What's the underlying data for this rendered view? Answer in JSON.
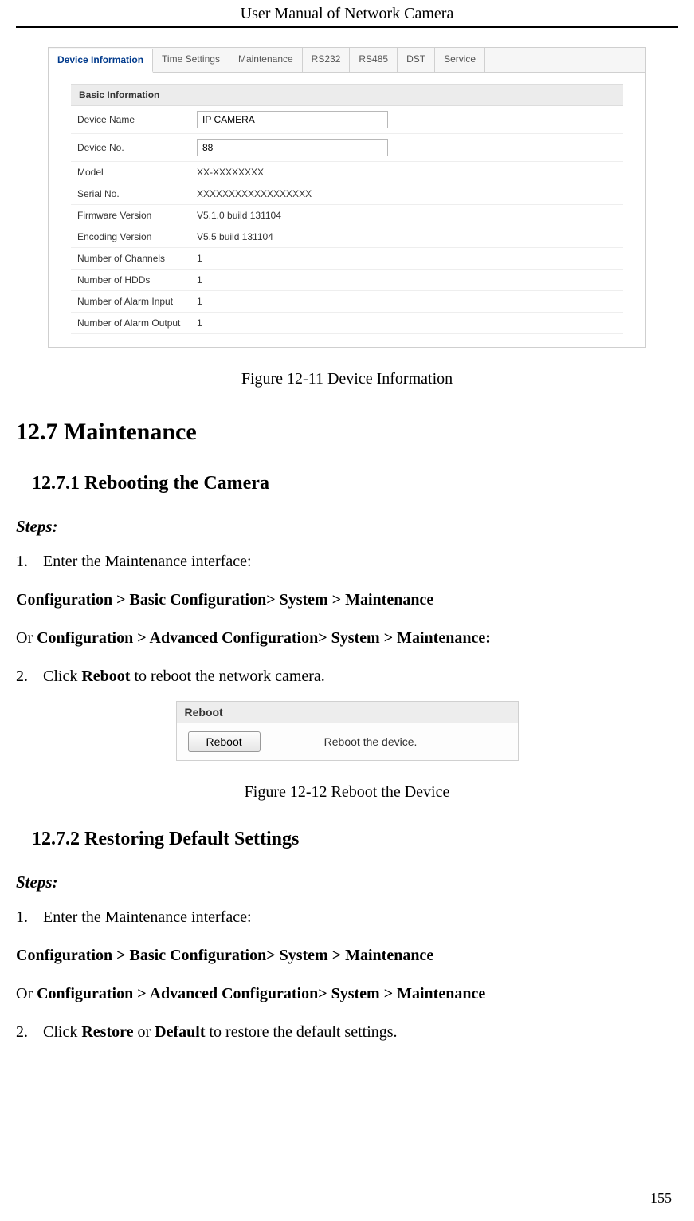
{
  "header": "User Manual of Network Camera",
  "pageNumber": "155",
  "fig1": {
    "tabs": [
      "Device Information",
      "Time Settings",
      "Maintenance",
      "RS232",
      "RS485",
      "DST",
      "Service"
    ],
    "activeTab": 0,
    "sectionHeader": "Basic Information",
    "inputs": {
      "deviceNameLabel": "Device Name",
      "deviceNameValue": "IP CAMERA",
      "deviceNoLabel": "Device No.",
      "deviceNoValue": "88"
    },
    "rows": [
      {
        "label": "Model",
        "value": "XX-XXXXXXXX"
      },
      {
        "label": "Serial No.",
        "value": "XXXXXXXXXXXXXXXXXX"
      },
      {
        "label": "Firmware Version",
        "value": "V5.1.0 build 131104"
      },
      {
        "label": "Encoding Version",
        "value": "V5.5 build 131104"
      },
      {
        "label": "Number of Channels",
        "value": "1"
      },
      {
        "label": "Number of HDDs",
        "value": "1"
      },
      {
        "label": "Number of Alarm Input",
        "value": "1"
      },
      {
        "label": "Number of Alarm Output",
        "value": "1"
      }
    ],
    "caption": "Figure 12-11 Device Information"
  },
  "sections": {
    "h1": "12.7 Maintenance",
    "h2a": "12.7.1 Rebooting the Camera",
    "h2b": "12.7.2 Restoring Default Settings",
    "stepsLabel": "Steps:",
    "s1": {
      "num1": "1.",
      "step1": "Enter the Maintenance interface:",
      "path1": "Configuration > Basic Configuration> System > Maintenance",
      "or": "Or ",
      "path2": "Configuration > Advanced Configuration> System > Maintenance:",
      "num2": "2.",
      "step2a": "Click ",
      "step2b": "Reboot",
      "step2c": " to reboot the network camera."
    },
    "s2": {
      "num1": "1.",
      "step1": "Enter the Maintenance interface:",
      "path1": "Configuration > Basic Configuration> System > Maintenance",
      "or": "Or ",
      "path2": "Configuration > Advanced Configuration> System > Maintenance",
      "num2": "2.",
      "step2a": "Click ",
      "step2b": "Restore",
      "step2c": " or ",
      "step2d": "Default",
      "step2e": " to restore the default settings."
    }
  },
  "fig2": {
    "header": "Reboot",
    "button": "Reboot",
    "desc": "Reboot the device.",
    "caption": "Figure 12-12 Reboot the Device"
  }
}
